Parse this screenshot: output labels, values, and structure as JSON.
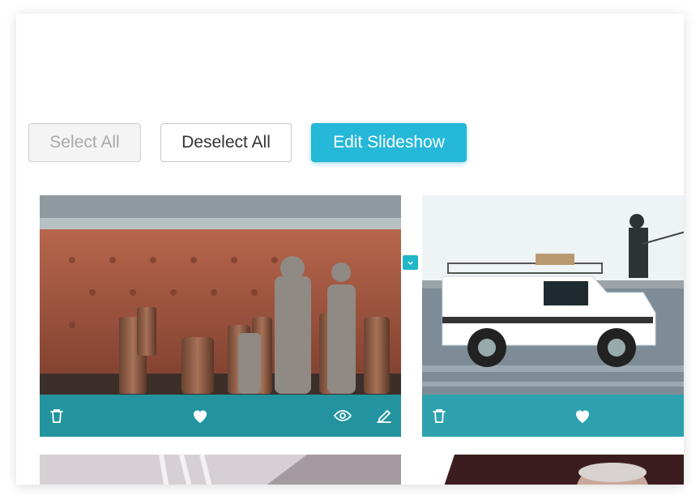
{
  "toolbar": {
    "select_all_label": "Select All",
    "deselect_all_label": "Deselect All",
    "edit_slideshow_label": "Edit Slideshow"
  },
  "colors": {
    "accent": "#25b8d8",
    "action_bar": "#20a5b2",
    "disabled_text": "#a9a9a9"
  },
  "photos": [
    {
      "subject": "chess pieces on a board",
      "actions": [
        "trash-icon",
        "heart-icon",
        "eye-icon",
        "pencil-icon"
      ]
    },
    {
      "subject": "white off-road vehicle in shallow water with a fisherman on the roof",
      "actions": [
        "trash-icon",
        "heart-icon"
      ]
    },
    {
      "subject": "interior ceiling",
      "actions": []
    },
    {
      "subject": "portrait of a man",
      "actions": []
    }
  ]
}
